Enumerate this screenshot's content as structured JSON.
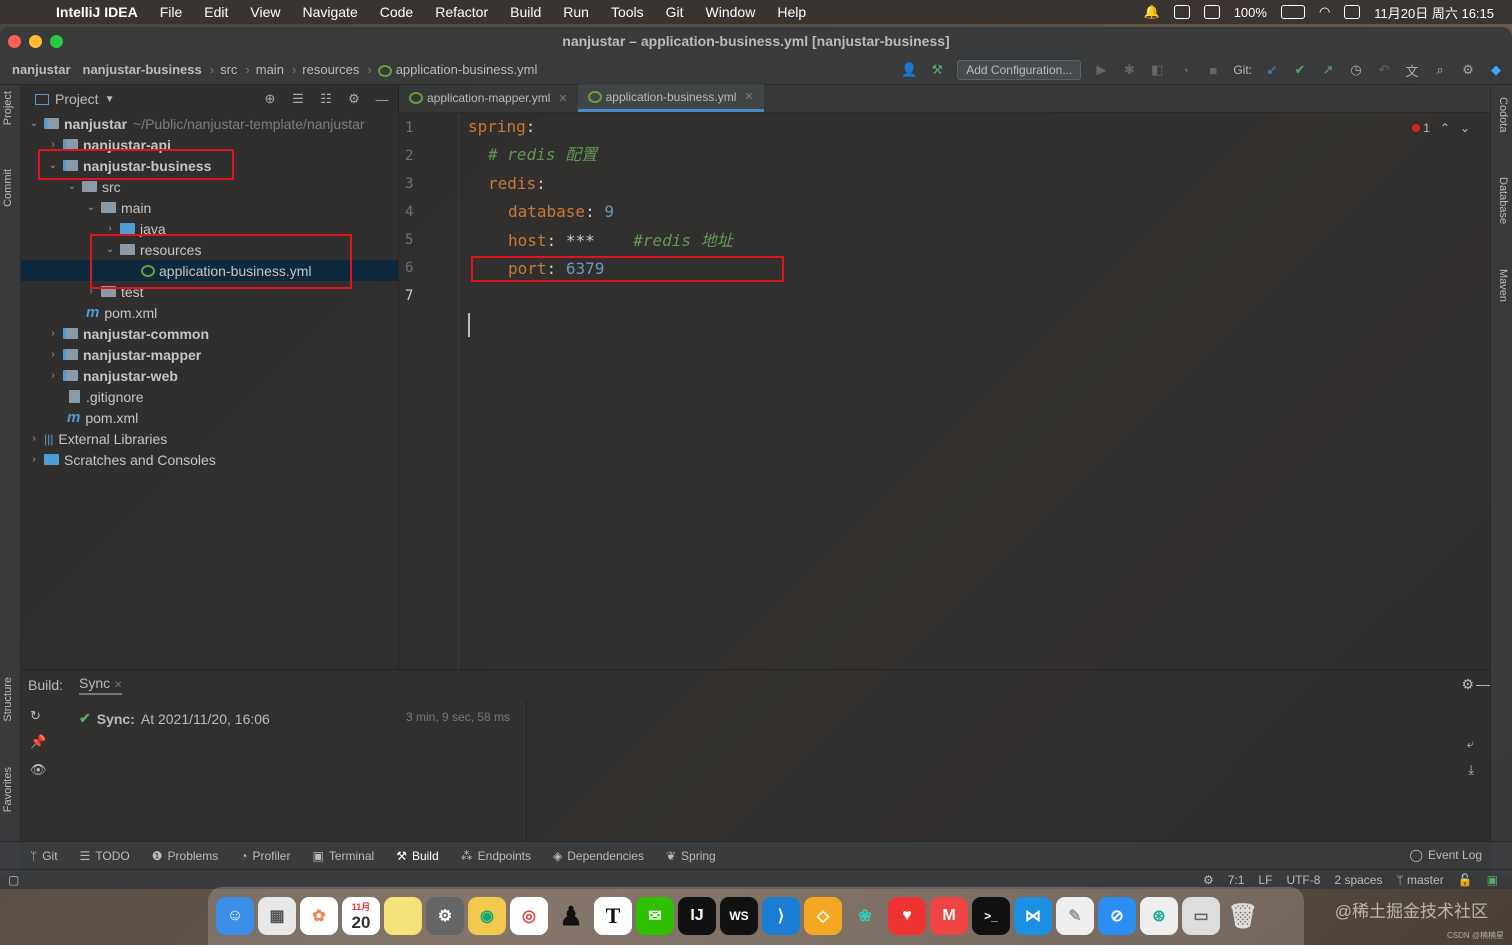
{
  "menubar": {
    "app": "IntelliJ IDEA",
    "items": [
      "File",
      "Edit",
      "View",
      "Navigate",
      "Code",
      "Refactor",
      "Build",
      "Run",
      "Tools",
      "Git",
      "Window",
      "Help"
    ],
    "battery": "100%",
    "datetime": "11月20日 周六 16:15"
  },
  "window": {
    "title": "nanjustar – application-business.yml [nanjustar-business]",
    "breadcrumbs": [
      "nanjustar",
      "nanjustar-business",
      "src",
      "main",
      "resources",
      "application-business.yml"
    ],
    "add_configuration": "Add Configuration...",
    "git_label": "Git:"
  },
  "left_strip": {
    "project": "Project",
    "commit": "Commit",
    "structure": "Structure",
    "favorites": "Favorites"
  },
  "right_strip": {
    "codota": "Codota",
    "database": "Database",
    "maven": "Maven"
  },
  "project": {
    "header": "Project",
    "tree": [
      {
        "label": "nanjustar",
        "extra": "~/Public/nanjustar-template/nanjustar"
      },
      {
        "label": "nanjustar-api"
      },
      {
        "label": "nanjustar-business"
      },
      {
        "label": "src"
      },
      {
        "label": "main"
      },
      {
        "label": "java"
      },
      {
        "label": "resources"
      },
      {
        "label": "application-business.yml"
      },
      {
        "label": "test"
      },
      {
        "label": "pom.xml"
      },
      {
        "label": "nanjustar-common"
      },
      {
        "label": "nanjustar-mapper"
      },
      {
        "label": "nanjustar-web"
      },
      {
        "label": ".gitignore"
      },
      {
        "label": "pom.xml"
      },
      {
        "label": "External Libraries"
      },
      {
        "label": "Scratches and Consoles"
      }
    ]
  },
  "editor": {
    "tabs": [
      "application-mapper.yml",
      "application-business.yml"
    ],
    "line_numbers": [
      "1",
      "2",
      "3",
      "4",
      "5",
      "6",
      "7"
    ],
    "code": {
      "l1_key": "spring",
      "l1_colon": ":",
      "l2_comment": "# redis 配置",
      "l3_key": "redis",
      "l3_colon": ":",
      "l4_key": "database",
      "l4_colon": ":",
      "l4_val": "9",
      "l5_key": "host",
      "l5_colon": ":",
      "l5_val": "***",
      "l5_comment": "#redis 地址",
      "l6_key": "port",
      "l6_colon": ":",
      "l6_val": "6379"
    },
    "error_count": "1"
  },
  "build": {
    "label": "Build:",
    "tab": "Sync",
    "status_label": "Sync:",
    "status_time": "At 2021/11/20, 16:06",
    "duration": "3 min, 9 sec, 58 ms"
  },
  "bottom_tabs": [
    "Git",
    "TODO",
    "Problems",
    "Profiler",
    "Terminal",
    "Build",
    "Endpoints",
    "Dependencies",
    "Spring"
  ],
  "event_log": "Event Log",
  "status": {
    "position": "7:1",
    "line_sep": "LF",
    "encoding": "UTF-8",
    "indent": "2 spaces",
    "branch": "master"
  },
  "dock": {
    "calendar_month": "11月",
    "calendar_day": "20"
  },
  "watermark": "@稀土掘金技术社区",
  "csdn": "CSDN @楠楠星"
}
